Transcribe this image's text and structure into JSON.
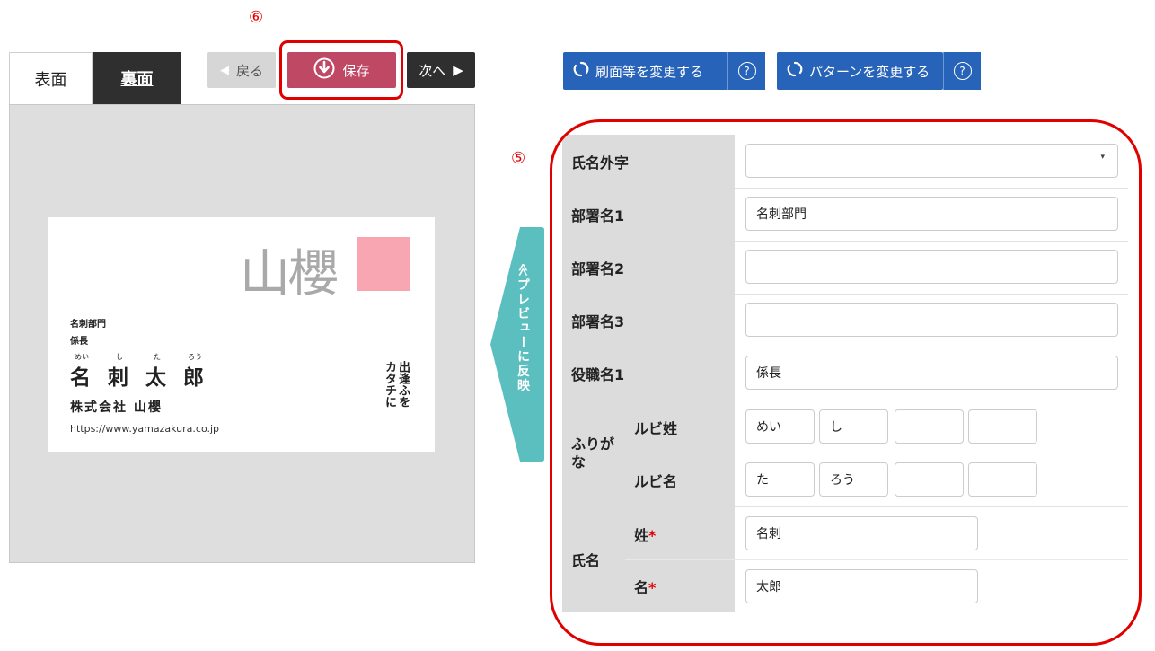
{
  "annotations": {
    "num5": "⑤",
    "num6": "⑥"
  },
  "tabs": {
    "front": "表面",
    "back": "裏面"
  },
  "toolbar": {
    "prev": "戻る",
    "save": "保存",
    "next": "次へ"
  },
  "actions": {
    "change_print": "刷面等を変更する",
    "change_pattern": "パターンを変更する",
    "help": "?"
  },
  "reflect_label": "≪プレビューに反映",
  "card": {
    "logo_text": "山櫻",
    "department": "名刺部門",
    "title": "係長",
    "name_chars": [
      "名",
      "刺",
      "太",
      "郎"
    ],
    "ruby_chars": [
      "めい",
      "し",
      "た",
      "ろう"
    ],
    "company": "株式会社 山櫻",
    "url": "https://www.yamazakura.co.jp",
    "vertical_line1": "出逢ふを",
    "vertical_line2": "カタチに",
    "accent_color": "#f7a6b2"
  },
  "form": {
    "gaiji_label": "氏名外字",
    "gaiji_value": "",
    "dept1_label": "部署名1",
    "dept1_value": "名刺部門",
    "dept2_label": "部署名2",
    "dept2_value": "",
    "dept3_label": "部署名3",
    "dept3_value": "",
    "role1_label": "役職名1",
    "role1_value": "係長",
    "furigana_label": "ふりがな",
    "ruby_sei_label": "ルビ姓",
    "ruby_sei_values": [
      "めい",
      "し",
      "",
      ""
    ],
    "ruby_mei_label": "ルビ名",
    "ruby_mei_values": [
      "た",
      "ろう",
      "",
      ""
    ],
    "name_label": "氏名",
    "sei_label": "姓",
    "sei_value": "名刺",
    "mei_label": "名",
    "mei_value": "太郎",
    "required_mark": "*"
  },
  "colors": {
    "save": "#bf4965",
    "primary": "#2763b8",
    "reflect": "#5bbfc0",
    "annotation": "#e00000"
  }
}
